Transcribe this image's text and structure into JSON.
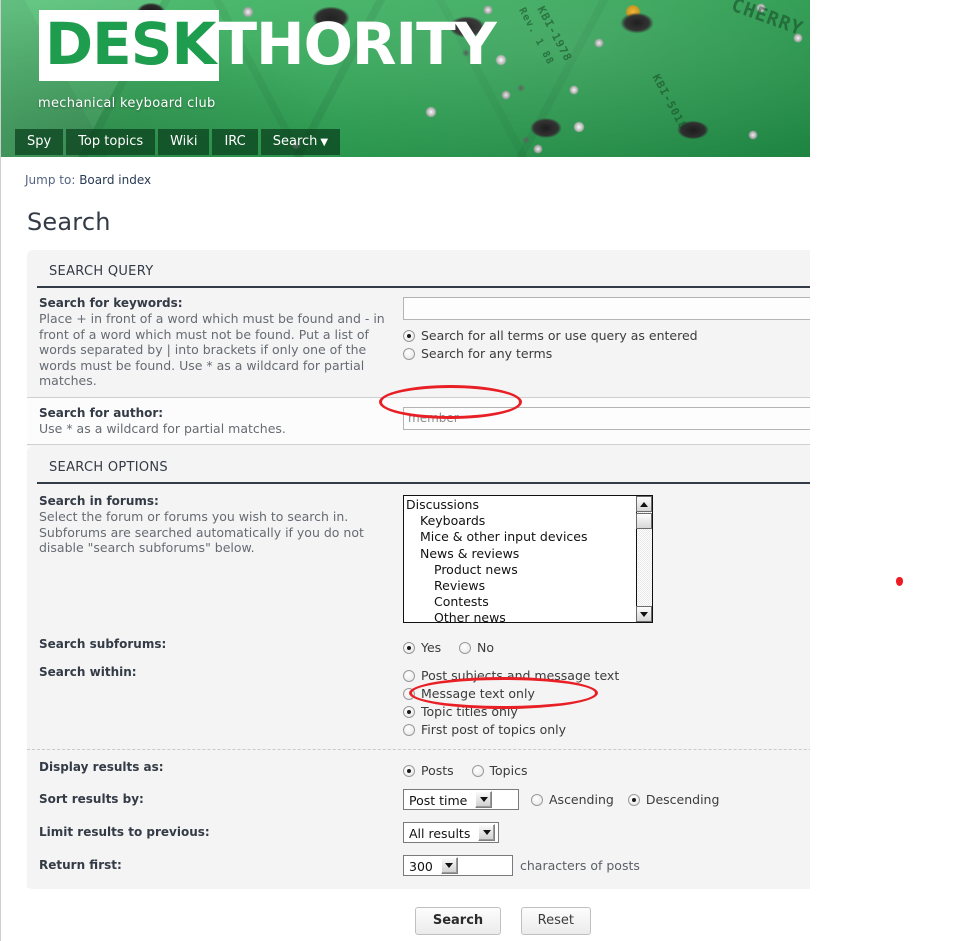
{
  "site": {
    "logo_primary": "DESK",
    "logo_secondary": "THORITY",
    "tagline": "mechanical keyboard club",
    "pcb_marks": {
      "m1": "KBI-1978",
      "m2": "Rev. 1  88",
      "m3": "CHERRY",
      "m4": "KBI-5018"
    }
  },
  "nav": {
    "items": [
      {
        "label": "Spy",
        "caret": ""
      },
      {
        "label": "Top topics",
        "caret": ""
      },
      {
        "label": "Wiki",
        "caret": ""
      },
      {
        "label": "IRC",
        "caret": ""
      },
      {
        "label": "Search",
        "caret": "▼"
      }
    ]
  },
  "breadcrumb": {
    "prefix": "Jump to:",
    "link": "Board index"
  },
  "page": {
    "title": "Search"
  },
  "search_query": {
    "heading": "SEARCH QUERY",
    "keywords": {
      "label": "Search for keywords:",
      "description": "Place + in front of a word which must be found and - in front of a word which must not be found. Put a list of words separated by | into brackets if only one of the words must be found. Use * as a wildcard for partial matches.",
      "value": "",
      "placeholder": "",
      "options": [
        {
          "label": "Search for all terms or use query as entered",
          "selected": true
        },
        {
          "label": "Search for any terms",
          "selected": false
        }
      ]
    },
    "author": {
      "label": "Search for author:",
      "description": "Use * as a wildcard for partial matches.",
      "value": "",
      "placeholder": "member"
    }
  },
  "search_options": {
    "heading": "SEARCH OPTIONS",
    "forums": {
      "label": "Search in forums:",
      "description": "Select the forum or forums you wish to search in. Subforums are searched automatically if you do not disable \"search subforums\" below.",
      "items": [
        {
          "label": "Discussions",
          "level": 0
        },
        {
          "label": "Keyboards",
          "level": 1
        },
        {
          "label": "Mice & other input devices",
          "level": 1
        },
        {
          "label": "News & reviews",
          "level": 1
        },
        {
          "label": "Product news",
          "level": 2
        },
        {
          "label": "Reviews",
          "level": 2
        },
        {
          "label": "Contests",
          "level": 2
        },
        {
          "label": "Other news",
          "level": 2
        }
      ]
    },
    "subforums": {
      "label": "Search subforums:",
      "options": [
        {
          "label": "Yes",
          "selected": true
        },
        {
          "label": "No",
          "selected": false
        }
      ]
    },
    "search_within": {
      "label": "Search within:",
      "options": [
        {
          "label": "Post subjects and message text",
          "selected": false
        },
        {
          "label": "Message text only",
          "selected": false
        },
        {
          "label": "Topic titles only",
          "selected": true
        },
        {
          "label": "First post of topics only",
          "selected": false
        }
      ]
    },
    "display_as": {
      "label": "Display results as:",
      "options": [
        {
          "label": "Posts",
          "selected": true
        },
        {
          "label": "Topics",
          "selected": false
        }
      ]
    },
    "sort_by": {
      "label": "Sort results by:",
      "value": "Post time",
      "direction": [
        {
          "label": "Ascending",
          "selected": false
        },
        {
          "label": "Descending",
          "selected": true
        }
      ]
    },
    "limit": {
      "label": "Limit results to previous:",
      "value": "All results"
    },
    "return_first": {
      "label": "Return first:",
      "value": "300",
      "suffix": "characters of posts"
    }
  },
  "buttons": {
    "search": "Search",
    "reset": "Reset"
  },
  "colors": {
    "brand_green": "#1f9d4f",
    "annotation_red": "#e81f25",
    "heading_dark": "#333b46"
  }
}
